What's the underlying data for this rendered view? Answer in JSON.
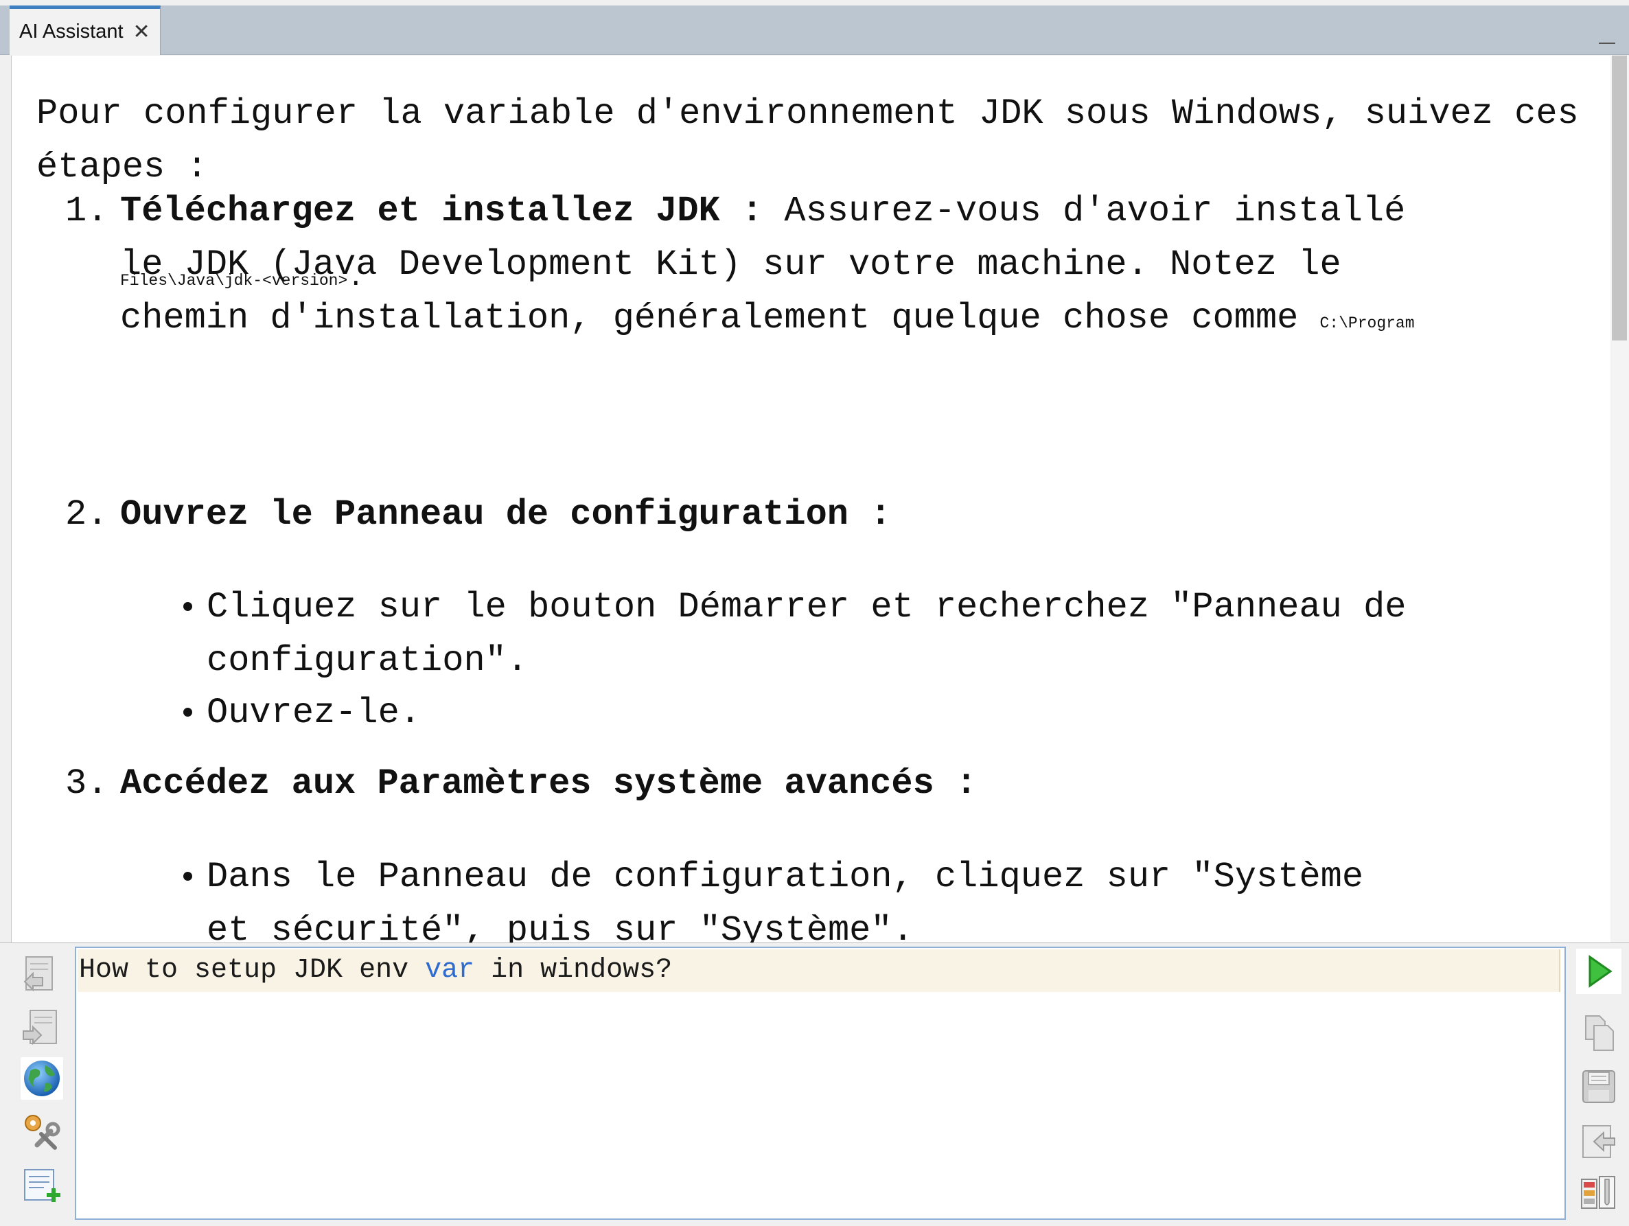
{
  "tab": {
    "title": "AI Assistant",
    "close_glyph": "✕"
  },
  "response": {
    "intro": "Pour configurer la variable d'environnement JDK sous Windows, suivez ces étapes :",
    "steps": [
      {
        "number": "1.",
        "title": "Téléchargez et installez JDK :",
        "text_line1": "Assurez-vous d'avoir installé",
        "text_line2": "le JDK (Java Development Kit) sur votre machine. Notez le",
        "text_line3": "chemin d'installation, généralement quelque chose comme",
        "code_part1": "C:\\Program",
        "code_part2": "Files\\Java\\jdk-<version>",
        "text_end": "."
      },
      {
        "number": "2.",
        "title": "Ouvrez le Panneau de configuration :",
        "bullets": [
          {
            "line1": "Cliquez sur le bouton Démarrer et recherchez \"Panneau de",
            "line2": "configuration\"."
          },
          {
            "line1": "Ouvrez-le.",
            "line2": ""
          }
        ]
      },
      {
        "number": "3.",
        "title": "Accédez aux Paramètres système avancés :",
        "bullets": [
          {
            "line1": "Dans le Panneau de configuration, cliquez sur \"Système",
            "line2": "et sécurité\", puis sur \"Système\"."
          }
        ]
      }
    ]
  },
  "input": {
    "query_before": "How to setup JDK env ",
    "query_keyword": "var",
    "query_after": " in windows?"
  },
  "left_toolbar": {
    "icons": [
      "previous-question-icon",
      "next-question-icon",
      "globe-icon",
      "settings-tools-icon",
      "new-chat-icon"
    ]
  },
  "right_toolbar": {
    "icons": [
      "send-icon",
      "copy-icon",
      "save-icon",
      "insert-icon",
      "clipboard-history-icon"
    ]
  },
  "colors": {
    "tab_accent": "#3d7fc1",
    "tabbar_bg": "#bcc6d0",
    "input_highlight": "#f8f3e4",
    "keyword": "#2e6bd1",
    "send_green": "#2fae2f"
  }
}
